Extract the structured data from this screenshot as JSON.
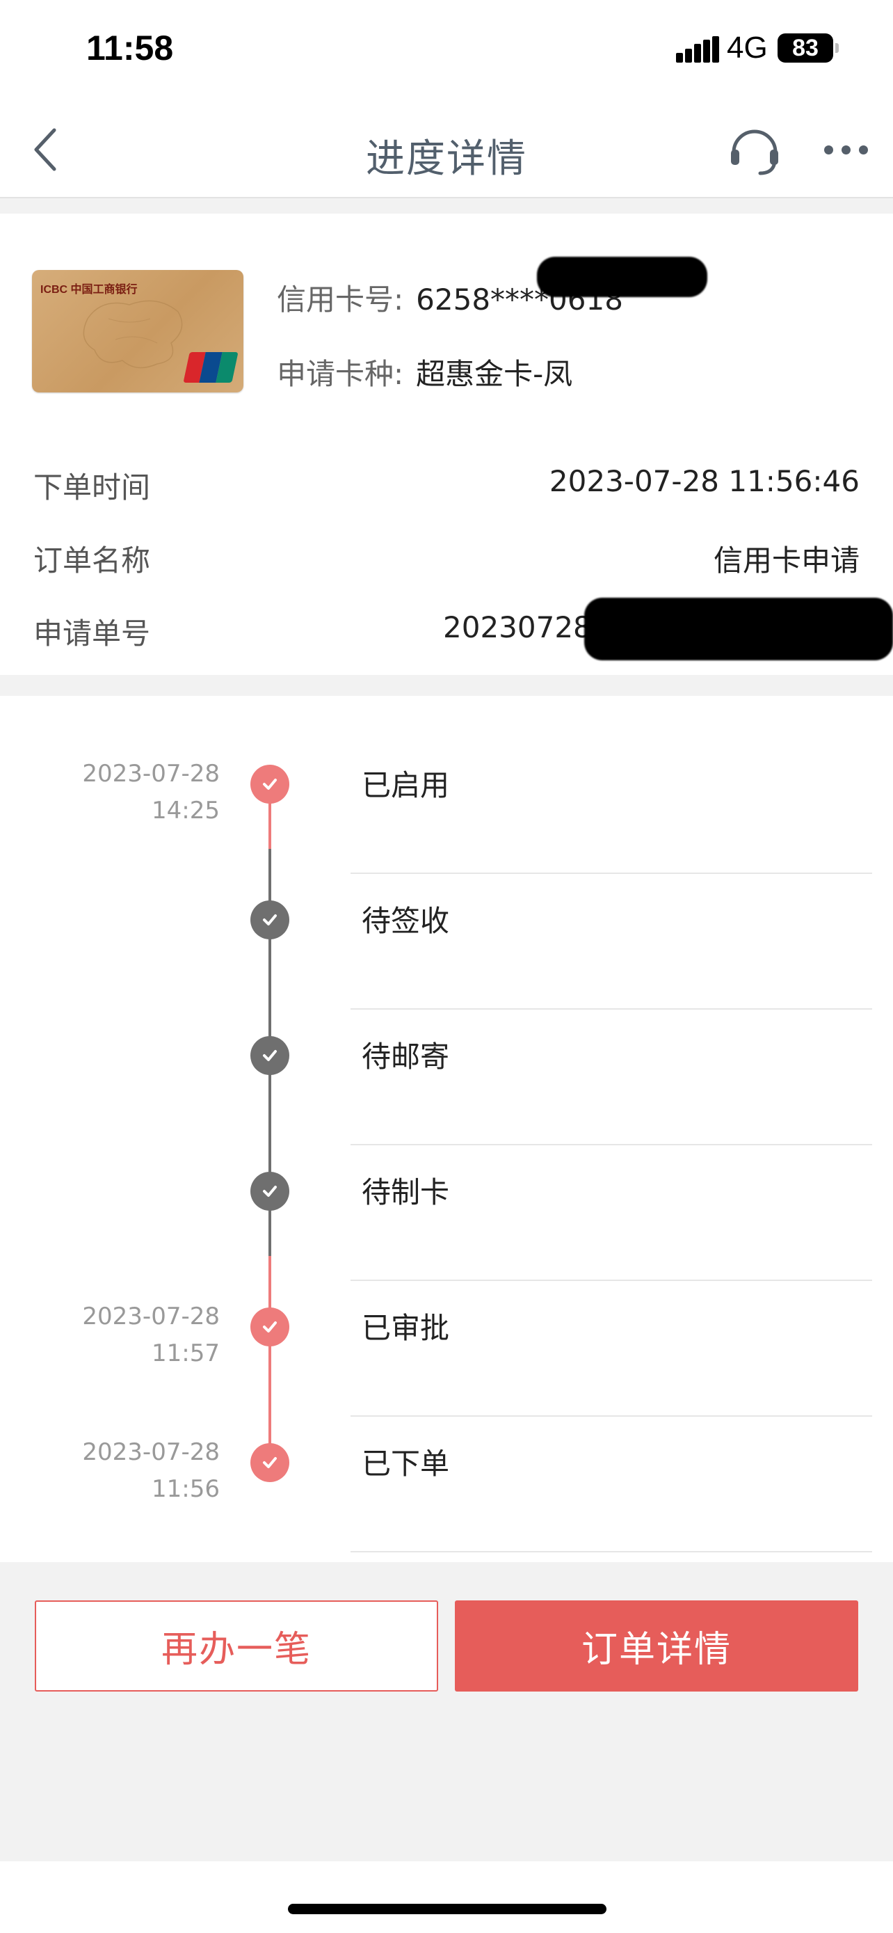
{
  "status_bar": {
    "time": "11:58",
    "network": "4G",
    "battery": "83"
  },
  "nav": {
    "title": "进度详情",
    "back_icon": "chevron-left-icon",
    "support_icon": "headset-icon",
    "more_icon": "more-dots-icon"
  },
  "card": {
    "image_label": "ICBC 中国工商银行",
    "number_label": "信用卡号:",
    "number_value": "6258****0618",
    "type_label": "申请卡种:",
    "type_value": "超惠金卡-凤"
  },
  "details": [
    {
      "label": "下单时间",
      "value": "2023-07-28 11:56:46"
    },
    {
      "label": "订单名称",
      "value": "信用卡申请"
    },
    {
      "label": "申请单号",
      "value": "20230728115"
    }
  ],
  "timeline": [
    {
      "date": "2023-07-28",
      "time": "14:25",
      "status": "已启用",
      "state": "done-red"
    },
    {
      "date": "",
      "time": "",
      "status": "待签收",
      "state": "done-gray"
    },
    {
      "date": "",
      "time": "",
      "status": "待邮寄",
      "state": "done-gray"
    },
    {
      "date": "",
      "time": "",
      "status": "待制卡",
      "state": "done-gray"
    },
    {
      "date": "2023-07-28",
      "time": "11:57",
      "status": "已审批",
      "state": "done-red"
    },
    {
      "date": "2023-07-28",
      "time": "11:56",
      "status": "已下单",
      "state": "done-red"
    }
  ],
  "buttons": {
    "again": "再办一笔",
    "order_detail": "订单详情"
  },
  "colors": {
    "accent": "#e65d5a",
    "timeline_red": "#ee7b7b",
    "timeline_gray": "#6f6f6f",
    "title": "#525f6c"
  }
}
